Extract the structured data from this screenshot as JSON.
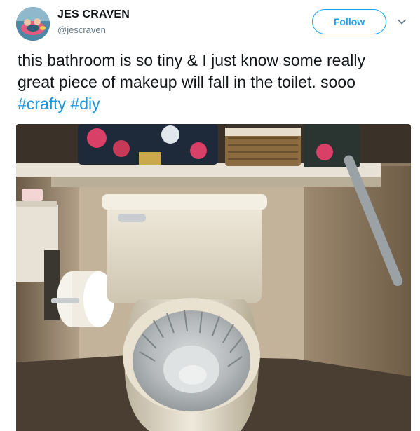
{
  "tweet": {
    "display_name": "JES CRAVEN",
    "handle": "@jescraven",
    "follow_label": "Follow",
    "text_main": "this bathroom is so tiny & I just know some really great piece of makeup will fall in the toilet. sooo ",
    "hashtags": [
      "#crafty",
      "#diy"
    ]
  },
  "icons": {
    "caret": "chevron-down-icon",
    "avatar": "user-avatar"
  },
  "colors": {
    "link": "#1b95e0",
    "follow_border": "#1da1f2",
    "handle": "#657786"
  }
}
